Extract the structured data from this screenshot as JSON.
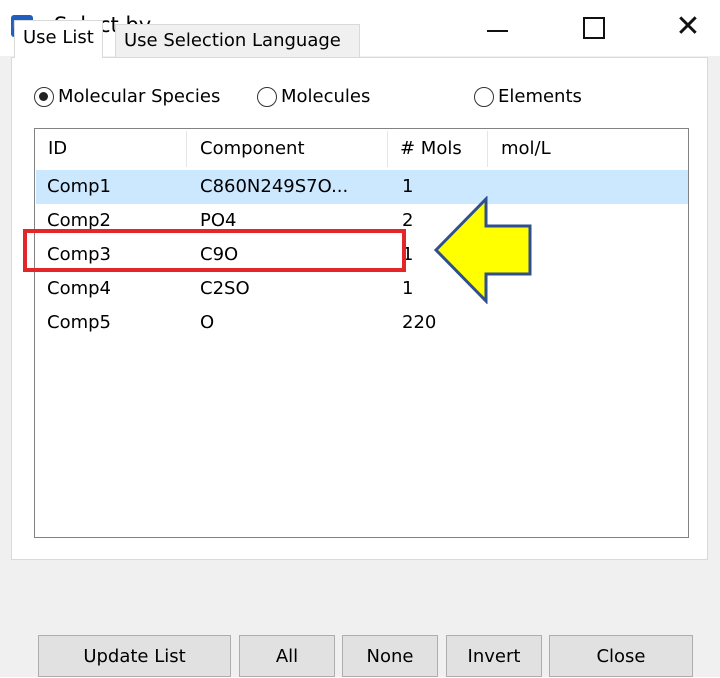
{
  "window": {
    "title": "Select by",
    "app_icon": "molecular-app-icon",
    "app_icon_glyph": "MM",
    "minimize_icon": "minimize-icon",
    "maximize_icon": "maximize-icon",
    "close_icon": "close-icon",
    "close_glyph": "✕"
  },
  "tabs": [
    {
      "label": "Use List",
      "active": true
    },
    {
      "label": "Use Selection Language",
      "active": false
    }
  ],
  "selection_type": {
    "options": [
      {
        "label": "Molecular Species",
        "selected": true
      },
      {
        "label": "Molecules",
        "selected": false
      },
      {
        "label": "Elements",
        "selected": false
      }
    ]
  },
  "table": {
    "columns": [
      "ID",
      "Component",
      "# Mols",
      "mol/L"
    ],
    "rows": [
      {
        "id": "Comp1",
        "component": "C860N249S7O...",
        "mols": "1",
        "mol_per_l": "",
        "selected": true
      },
      {
        "id": "Comp2",
        "component": "PO4",
        "mols": "2",
        "mol_per_l": ""
      },
      {
        "id": "Comp3",
        "component": "C9O",
        "mols": "1",
        "mol_per_l": ""
      },
      {
        "id": "Comp4",
        "component": "C2SO",
        "mols": "1",
        "mol_per_l": ""
      },
      {
        "id": "Comp5",
        "component": "O",
        "mols": "220",
        "mol_per_l": ""
      }
    ]
  },
  "annotations": {
    "highlight_color": "#e3262a",
    "arrow_fill": "#ffff00",
    "arrow_stroke": "#2f4f8f"
  },
  "buttons": {
    "update_list": "Update List",
    "all": "All",
    "none": "None",
    "invert": "Invert",
    "close": "Close"
  },
  "colors": {
    "selected_row": "#cce8ff",
    "dialog_bg": "#f0f0f0"
  }
}
